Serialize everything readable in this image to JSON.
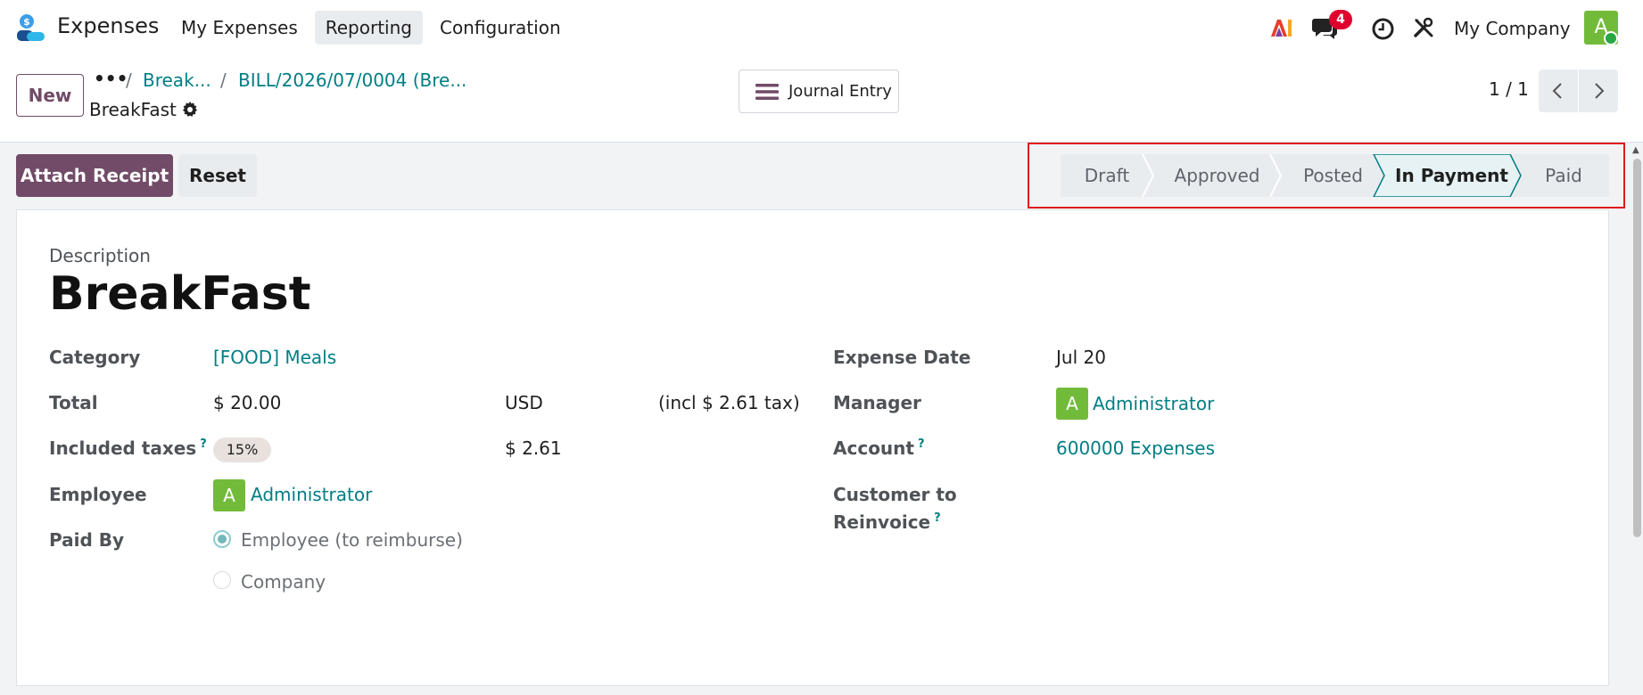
{
  "navbar": {
    "app_name": "Expenses",
    "menu": [
      "My Expenses",
      "Reporting",
      "Configuration"
    ],
    "active_menu": "Reporting",
    "chat_badge": "4",
    "company": "My Company",
    "avatar_initial": "A"
  },
  "control_panel": {
    "new_label": "New",
    "breadcrumb_dots": "•••",
    "breadcrumb_sep": "/",
    "breadcrumb_1": "Break...",
    "breadcrumb_2": "BILL/2026/07/0004 (Bre...",
    "record_name": "BreakFast",
    "journal_entry_label": "Journal Entry",
    "pager": "1 / 1"
  },
  "actions": {
    "attach_receipt": "Attach Receipt",
    "reset": "Reset"
  },
  "statusbar": {
    "stages": [
      "Draft",
      "Approved",
      "Posted",
      "In Payment",
      "Paid"
    ],
    "current": "In Payment"
  },
  "form": {
    "description_label": "Description",
    "description_value": "BreakFast",
    "category_label": "Category",
    "category_value": "[FOOD] Meals",
    "total_label": "Total",
    "total_value": "$ 20.00",
    "currency": "USD",
    "tax_note": "(incl $ 2.61 tax)",
    "included_taxes_label": "Included taxes",
    "help_mark": "?",
    "tax_pill": "15%",
    "tax_amount": "$ 2.61",
    "employee_label": "Employee",
    "employee_initial": "A",
    "employee_value": "Administrator",
    "paid_by_label": "Paid By",
    "paid_by_options": [
      "Employee (to reimburse)",
      "Company"
    ],
    "paid_by_selected": "Employee (to reimburse)",
    "expense_date_label": "Expense Date",
    "expense_date_value": "Jul 20",
    "manager_label": "Manager",
    "manager_initial": "A",
    "manager_value": "Administrator",
    "account_label": "Account",
    "account_value": "600000 Expenses",
    "customer_label_line1": "Customer to",
    "customer_label_line2": "Reinvoice"
  },
  "colors": {
    "brand": "#714b67",
    "link": "#017e84",
    "badge": "#e0002e",
    "avatar": "#72bb3a",
    "highlight": "#e01a1a"
  }
}
